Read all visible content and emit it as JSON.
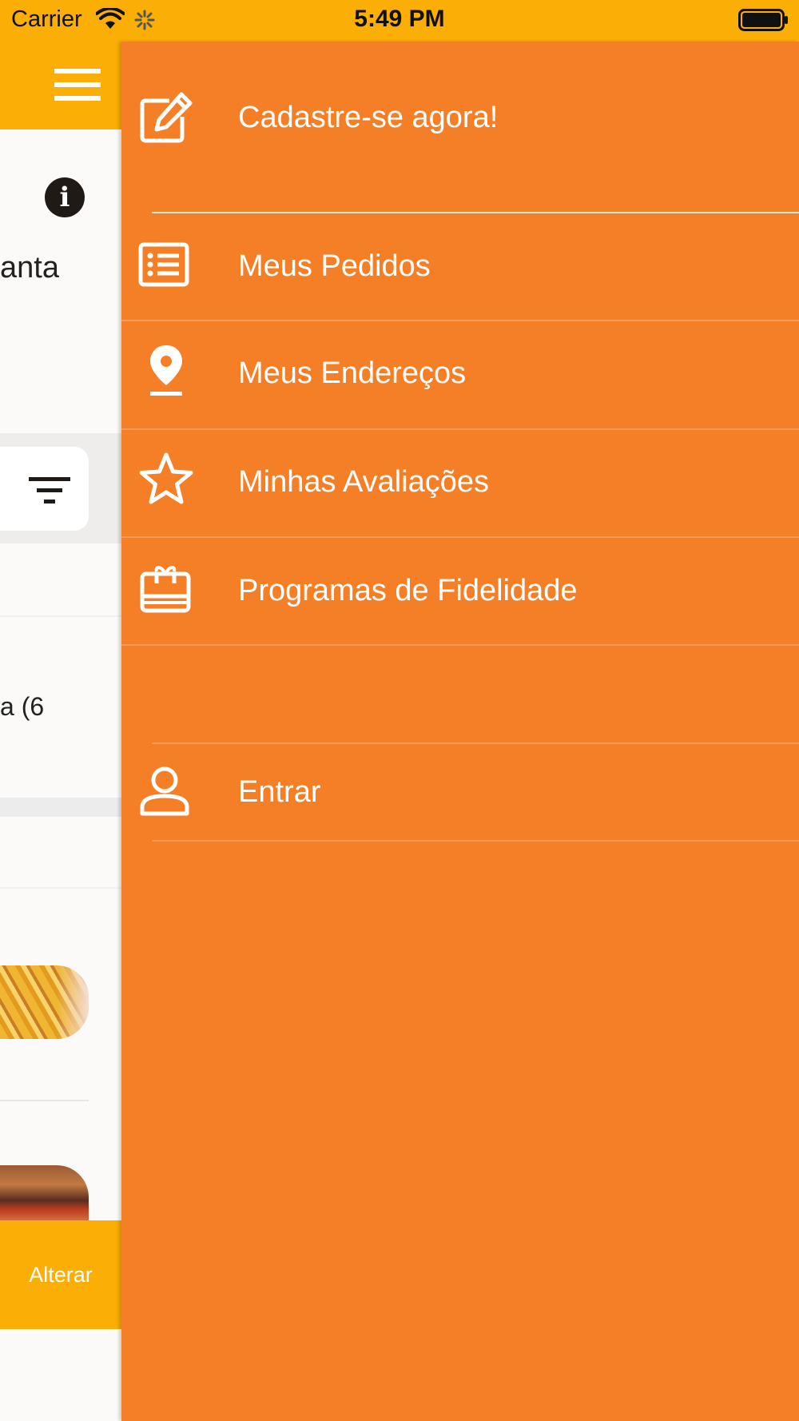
{
  "status_bar": {
    "carrier": "Carrier",
    "time": "5:49 PM",
    "background_color": "#fbae05"
  },
  "background_app": {
    "header_color": "#fbae05",
    "partial_text_1": "anta",
    "partial_text_2": "a (6",
    "change_button_label": "Alterar",
    "icons": [
      "menu-icon",
      "info-icon",
      "filter-icon"
    ]
  },
  "drawer": {
    "background_color": "#f57f27",
    "items": [
      {
        "label": "Cadastre-se agora!",
        "icon": "edit-icon"
      },
      {
        "label": "Meus Pedidos",
        "icon": "list-icon"
      },
      {
        "label": "Meus Endereços",
        "icon": "location-pin-icon"
      },
      {
        "label": "Minhas Avaliações",
        "icon": "star-icon"
      },
      {
        "label": "Programas de Fidelidade",
        "icon": "gift-card-icon"
      },
      {
        "label": "Entrar",
        "icon": "user-icon"
      }
    ]
  }
}
